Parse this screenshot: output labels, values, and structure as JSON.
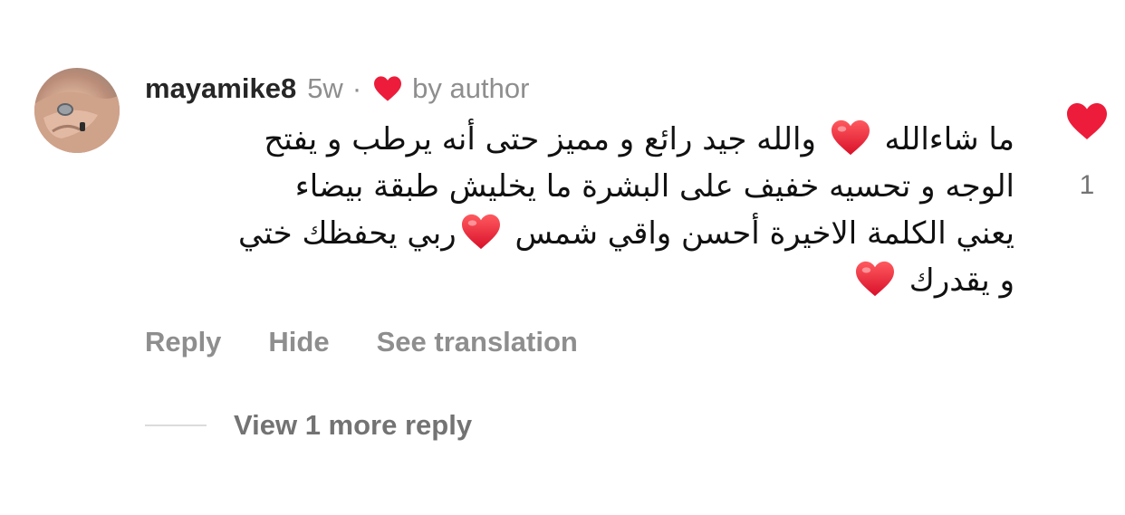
{
  "comment": {
    "username": "mayamike8",
    "time_ago": "5w",
    "separator": "·",
    "author_like_label": "by author",
    "text_lines": [
      {
        "before": "ما شاءالله ",
        "after": " والله جيد رائع و مميز حتى أنه يرطب و يفتح",
        "heart": "before-end"
      },
      {
        "text": "الوجه و تحسيه خفيف على البشرة ما يخليش طبقة بيضاء"
      },
      {
        "before": "يعني الكلمة الاخيرة أحسن واقي شمس ",
        "after": "ربي يحفظك ختي"
      },
      {
        "before": "و يقدرك "
      }
    ],
    "like_count": "1",
    "heart_color": "#ed1c3a"
  },
  "actions": {
    "reply_label": "Reply",
    "hide_label": "Hide",
    "translate_label": "See translation"
  },
  "replies": {
    "view_more_label": "View 1 more reply"
  },
  "icons": {
    "avatar": "user-avatar",
    "author_heart": "heart-filled-icon",
    "like": "heart-filled-icon",
    "emoji": "red-heart-emoji"
  }
}
